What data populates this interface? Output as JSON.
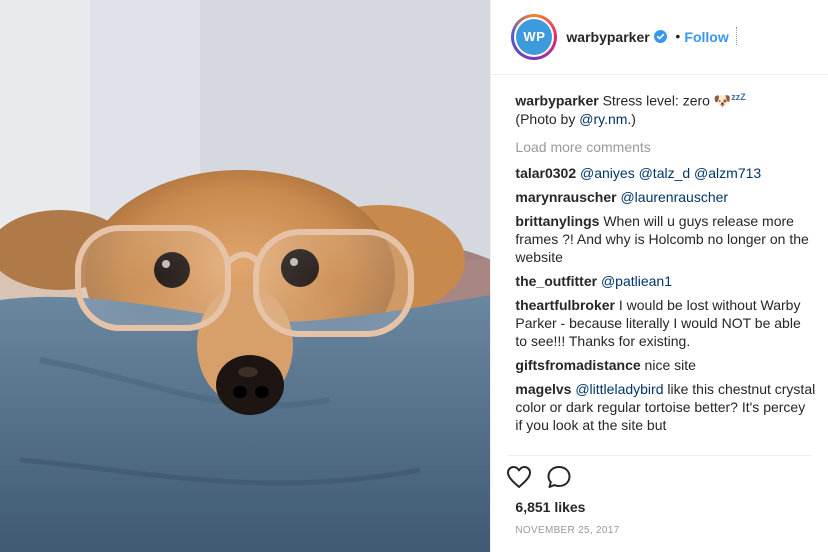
{
  "post": {
    "photo_alt": "dog wearing glasses resting on a pillow"
  },
  "header": {
    "avatar_text": "WP",
    "username": "warbyparker",
    "separator": "•",
    "follow_label": "Follow"
  },
  "caption": {
    "username": "warbyparker",
    "text": "Stress level: zero 🐶",
    "zzz": "zzZ",
    "credit_prefix": "(Photo by ",
    "credit_mention": "@ry.nm.",
    "credit_suffix": ")"
  },
  "load_more_label": "Load more comments",
  "comments": [
    {
      "user": "talar0302",
      "mentions": "@aniyes @talz_d @alzm713",
      "text": ""
    },
    {
      "user": "marynrauscher",
      "mentions": "@laurenrauscher",
      "text": ""
    },
    {
      "user": "brittanylings",
      "mentions": "",
      "text": "When will u guys release more frames ?! And why is Holcomb no longer on the website"
    },
    {
      "user": "the_outfitter",
      "mentions": "@patliean1",
      "text": ""
    },
    {
      "user": "theartfulbroker",
      "mentions": "",
      "text": "I would be lost without Warby Parker - because literally I would NOT be able to see!!! Thanks for existing."
    },
    {
      "user": "giftsfromadistance",
      "mentions": "",
      "text": "nice site"
    },
    {
      "user": "magelvs",
      "mentions": "@littleladybird",
      "text": "like this chestnut crystal color or dark regular tortoise better? It's percey if you look at the site but"
    }
  ],
  "actions": {
    "like_icon": "heart-icon",
    "comment_icon": "comment-icon"
  },
  "likes_label": "6,851 likes",
  "date_label": "NOVEMBER 25, 2017",
  "colors": {
    "link": "#003569",
    "follow": "#3897f0",
    "avatar_bg": "#3d9bdc"
  }
}
